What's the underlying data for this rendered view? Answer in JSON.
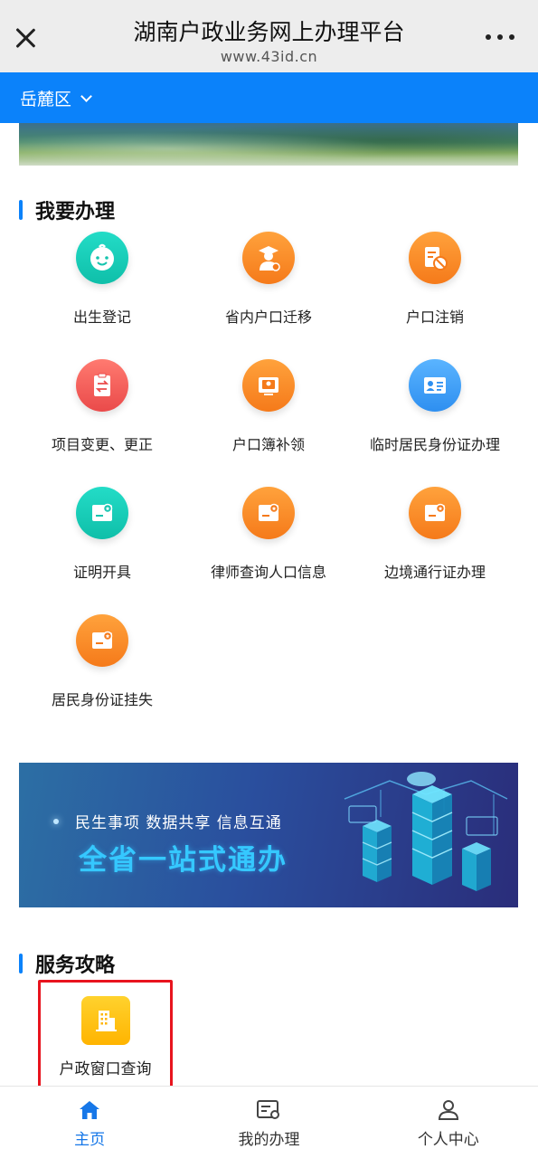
{
  "browser": {
    "title": "湖南户政业务网上办理平台",
    "url": "www.43id.cn"
  },
  "region": {
    "label": "岳麓区"
  },
  "section_apply": {
    "title": "我要办理",
    "items": [
      {
        "label": "出生登记",
        "icon": "baby-face-icon",
        "color": "#1fd1bb"
      },
      {
        "label": "省内户口迁移",
        "icon": "graduate-person-icon",
        "color": "#ff8c2a"
      },
      {
        "label": "户口注销",
        "icon": "cancel-document-icon",
        "color": "#ff8c2a"
      },
      {
        "label": "项目变更、更正",
        "icon": "clipboard-exchange-icon",
        "color": "#f25c57"
      },
      {
        "label": "户口簿补领",
        "icon": "id-card-screen-icon",
        "color": "#ff8c2a"
      },
      {
        "label": "临时居民身份证办理",
        "icon": "contact-card-icon",
        "color": "#3ea2f8"
      },
      {
        "label": "证明开具",
        "icon": "certificate-star-icon",
        "color": "#1fd1bb"
      },
      {
        "label": "律师查询人口信息",
        "icon": "certificate-star-icon",
        "color": "#ff8c2a"
      },
      {
        "label": "边境通行证办理",
        "icon": "certificate-star-icon",
        "color": "#ff8c2a"
      },
      {
        "label": "居民身份证挂失",
        "icon": "certificate-star-icon",
        "color": "#ff8c2a"
      }
    ]
  },
  "promo": {
    "line1": "民生事项  数据共享  信息互通",
    "line2": "全省一站式通办"
  },
  "section_guide": {
    "title": "服务攻略",
    "items": [
      {
        "label": "户政窗口查询",
        "icon": "office-building-icon",
        "color": "#ffc21a"
      }
    ]
  },
  "tabs": [
    {
      "label": "主页",
      "icon": "home-icon",
      "active": true
    },
    {
      "label": "我的办理",
      "icon": "task-list-icon",
      "active": false
    },
    {
      "label": "个人中心",
      "icon": "user-icon",
      "active": false
    }
  ],
  "colors": {
    "accent": "#0b82fa",
    "highlight_border": "#e8141e",
    "active_tab": "#1677e8"
  }
}
